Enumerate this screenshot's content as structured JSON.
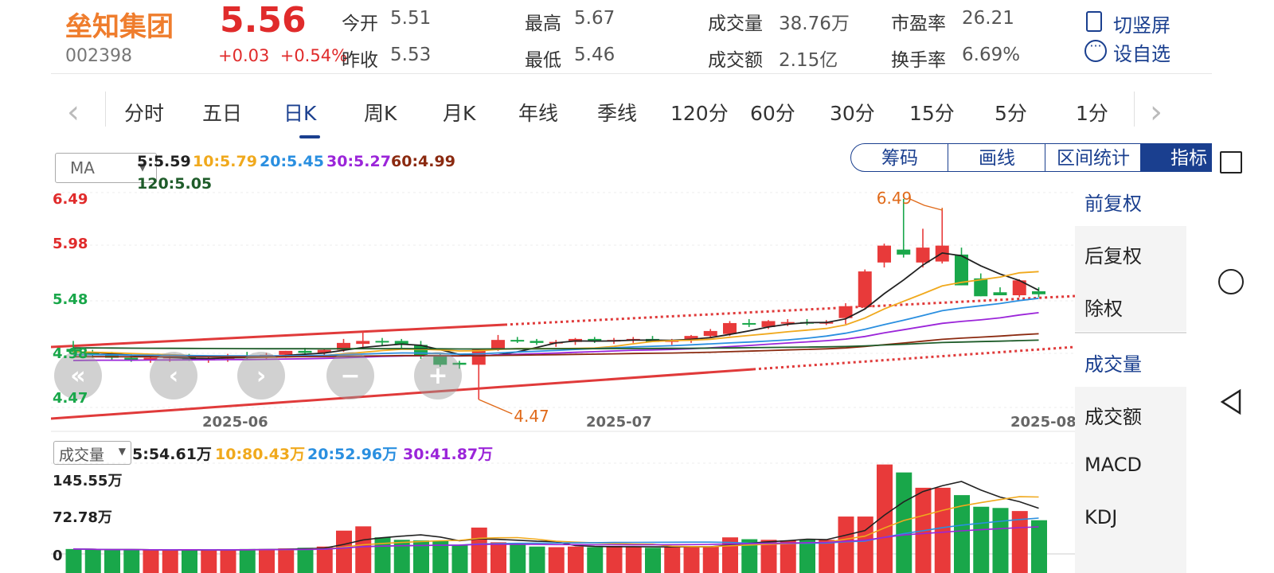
{
  "stock": {
    "name": "垒知集团",
    "code": "002398",
    "price": "5.56",
    "change": "+0.03",
    "change_pct": "+0.54%",
    "open_label": "今开",
    "open": "5.51",
    "prev_close_label": "昨收",
    "prev_close": "5.53",
    "high_label": "最高",
    "high": "5.67",
    "low_label": "最低",
    "low": "5.46",
    "volume_label": "成交量",
    "volume": "38.76万",
    "amount_label": "成交额",
    "amount": "2.15亿",
    "pe_label": "市盈率",
    "pe": "26.21",
    "turnover_label": "换手率",
    "turnover": "6.69%"
  },
  "actions": {
    "switch_label": "切竖屏",
    "watch_label": "设自选"
  },
  "tabs": [
    "分时",
    "五日",
    "日K",
    "周K",
    "月K",
    "年线",
    "季线",
    "120分",
    "60分",
    "30分",
    "15分",
    "5分",
    "1分"
  ],
  "active_tab": "日K",
  "indicator": {
    "select": "MA",
    "ma5": "5:5.59",
    "ma10": "10:5.79",
    "ma20": "20:5.45",
    "ma30": "30:5.27",
    "ma60": "60:4.99",
    "ma120": "120:5.05"
  },
  "tool_buttons": [
    "筹码",
    "画线",
    "区间统计",
    "指标"
  ],
  "menu": [
    "前复权",
    "后复权",
    "除权",
    "成交量",
    "成交额",
    "MACD",
    "KDJ"
  ],
  "price_axis": {
    "labels": [
      "6.49",
      "5.98",
      "5.48",
      "4.98",
      "4.47"
    ]
  },
  "date_labels": [
    "2025-06",
    "2025-07",
    "2025-08"
  ],
  "annotations": {
    "high": "6.49",
    "low": "4.47"
  },
  "volume": {
    "select": "成交量",
    "ma5": "5:54.61万",
    "ma10": "10:80.43万",
    "ma20": "20:52.96万",
    "ma30": "30:41.87万",
    "axis": [
      "145.55万",
      "72.78万",
      "0"
    ]
  },
  "colors": {
    "up": "#e83a3a",
    "down": "#19a74a",
    "ma5": "#222222",
    "ma10": "#f0a91d",
    "ma20": "#2a8fe0",
    "ma30": "#9b25d9",
    "ma60": "#8b2a10",
    "ma120": "#1f5c2a",
    "accent": "#1a3f8f",
    "brand": "#ef7d2d"
  },
  "chart_data": {
    "type": "candlestick",
    "series": [
      {
        "name": "K",
        "ohlc": [
          [
            4.98,
            5.06,
            4.94,
            4.95
          ],
          [
            4.94,
            4.97,
            4.89,
            4.92
          ],
          [
            4.92,
            4.95,
            4.87,
            4.89
          ],
          [
            4.89,
            4.93,
            4.85,
            4.87
          ],
          [
            4.87,
            4.91,
            4.84,
            4.89
          ],
          [
            4.89,
            4.92,
            4.85,
            4.9
          ],
          [
            4.9,
            4.93,
            4.86,
            4.87
          ],
          [
            4.87,
            4.91,
            4.84,
            4.88
          ],
          [
            4.88,
            4.93,
            4.85,
            4.91
          ],
          [
            4.91,
            4.95,
            4.88,
            4.9
          ],
          [
            4.9,
            4.94,
            4.87,
            4.92
          ],
          [
            4.92,
            4.96,
            4.89,
            4.96
          ],
          [
            4.96,
            4.99,
            4.92,
            4.94
          ],
          [
            4.94,
            4.98,
            4.91,
            4.97
          ],
          [
            4.97,
            5.08,
            4.95,
            5.04
          ],
          [
            5.03,
            5.16,
            5.0,
            5.06
          ],
          [
            5.06,
            5.09,
            5.01,
            5.05
          ],
          [
            5.06,
            5.08,
            4.99,
            5.02
          ],
          [
            5.02,
            5.06,
            4.88,
            4.91
          ],
          [
            4.91,
            4.94,
            4.8,
            4.82
          ],
          [
            4.84,
            4.86,
            4.78,
            4.82
          ],
          [
            4.82,
            4.94,
            4.47,
            4.98
          ],
          [
            4.98,
            5.12,
            4.96,
            5.07
          ],
          [
            5.07,
            5.1,
            5.04,
            5.06
          ],
          [
            5.06,
            5.08,
            5.02,
            5.04
          ],
          [
            5.04,
            5.07,
            5.0,
            5.05
          ],
          [
            5.05,
            5.09,
            5.02,
            5.08
          ],
          [
            5.08,
            5.1,
            5.04,
            5.06
          ],
          [
            5.06,
            5.09,
            5.03,
            5.07
          ],
          [
            5.07,
            5.1,
            5.04,
            5.08
          ],
          [
            5.08,
            5.11,
            5.05,
            5.05
          ],
          [
            5.05,
            5.08,
            5.02,
            5.07
          ],
          [
            5.07,
            5.12,
            5.04,
            5.11
          ],
          [
            5.11,
            5.18,
            5.09,
            5.16
          ],
          [
            5.13,
            5.26,
            5.11,
            5.24
          ],
          [
            5.24,
            5.28,
            5.2,
            5.23
          ],
          [
            5.2,
            5.27,
            5.18,
            5.26
          ],
          [
            5.24,
            5.28,
            5.21,
            5.25
          ],
          [
            5.25,
            5.28,
            5.22,
            5.24
          ],
          [
            5.24,
            5.27,
            5.22,
            5.25
          ],
          [
            5.29,
            5.44,
            5.23,
            5.41
          ],
          [
            5.4,
            5.78,
            5.38,
            5.76
          ],
          [
            5.85,
            6.04,
            5.8,
            6.02
          ],
          [
            5.98,
            6.49,
            5.9,
            5.93
          ],
          [
            5.85,
            6.19,
            5.8,
            6.0
          ],
          [
            5.86,
            6.4,
            5.84,
            6.02
          ],
          [
            5.93,
            6.0,
            5.62,
            5.62
          ],
          [
            5.69,
            5.74,
            5.51,
            5.51
          ],
          [
            5.55,
            5.6,
            5.52,
            5.52
          ],
          [
            5.52,
            5.68,
            5.5,
            5.67
          ],
          [
            5.56,
            5.6,
            5.5,
            5.53
          ]
        ]
      },
      {
        "name": "成交量",
        "values": [
          8,
          7,
          6,
          7,
          6,
          6,
          7,
          6,
          7,
          8,
          8,
          9,
          10,
          12,
          38,
          45,
          27,
          23,
          22,
          21,
          14,
          43,
          19,
          15,
          12,
          11,
          12,
          11,
          13,
          12,
          10,
          11,
          13,
          12,
          27,
          24,
          23,
          22,
          24,
          23,
          61,
          61,
          146,
          133,
          108,
          108,
          96,
          77,
          75,
          70,
          55
        ]
      }
    ]
  }
}
